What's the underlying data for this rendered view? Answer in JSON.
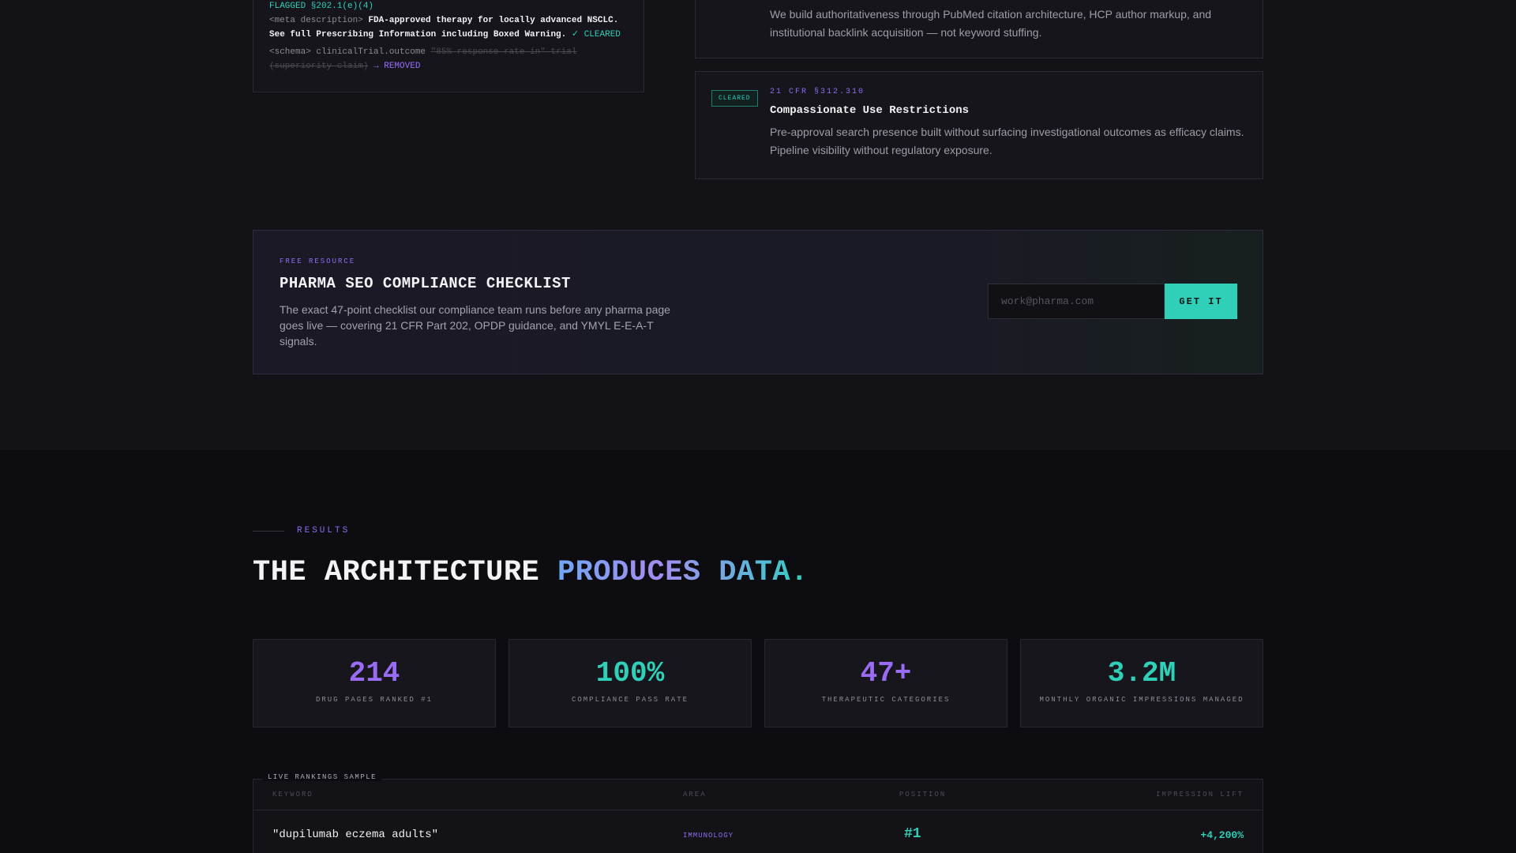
{
  "code_card": {
    "flag_line": "FLAGGED §202.1(e)(4)",
    "meta_tag": "<meta description>",
    "meta_value": "FDA-approved therapy for locally advanced NSCLC. See full Prescribing Information including Boxed Warning.",
    "meta_status": "✓ CLEARED",
    "schema_tag": "<schema> clinicalTrial.outcome",
    "schema_struck": "\"85% response rate in\" trial (superiority claim)",
    "schema_status": "→ REMOVED"
  },
  "rules": [
    {
      "description": "We build authoritativeness through PubMed citation architecture, HCP author markup, and institutional backlink acquisition — not keyword stuffing."
    },
    {
      "badge": "CLEARED",
      "code": "21 CFR §312.310",
      "title": "Compassionate Use Restrictions",
      "description": "Pre-approval search presence built without surfacing investigational outcomes as efficacy claims. Pipeline visibility without regulatory exposure."
    }
  ],
  "resource": {
    "kicker": "FREE RESOURCE",
    "title": "PHARMA SEO COMPLIANCE CHECKLIST",
    "description": "The exact 47-point checklist our compliance team runs before any pharma page goes live — covering 21 CFR Part 202, OPDP guidance, and YMYL E-E-A-T signals.",
    "email_placeholder": "work@pharma.com",
    "button_label": "GET IT"
  },
  "results": {
    "label": "RESULTS",
    "headline_plain": "THE ARCHITECTURE ",
    "headline_accent": "PRODUCES DATA.",
    "stats": [
      {
        "value": "214",
        "label": "DRUG PAGES RANKED #1",
        "color": "#9a6cf5"
      },
      {
        "value": "100%",
        "label": "COMPLIANCE PASS RATE",
        "color": "#2fcfb8"
      },
      {
        "value": "47+",
        "label": "THERAPEUTIC CATEGORIES",
        "color": "#9a6cf5"
      },
      {
        "value": "3.2M",
        "label": "MONTHLY ORGANIC IMPRESSIONS MANAGED",
        "color": "#2fcfb8"
      }
    ]
  },
  "rankings": {
    "caption": "LIVE RANKINGS SAMPLE",
    "columns": {
      "keyword": "KEYWORD",
      "area": "AREA",
      "position": "POSITION",
      "lift": "IMPRESSION LIFT"
    },
    "rows": [
      {
        "keyword": "\"dupilumab eczema adults\"",
        "area": "IMMUNOLOGY",
        "position": "#1",
        "lift": "+4,200%"
      }
    ]
  },
  "colors": {
    "accent_teal": "#2fcfb8",
    "accent_purple": "#8f6cf0",
    "background": "#0d0d11"
  }
}
